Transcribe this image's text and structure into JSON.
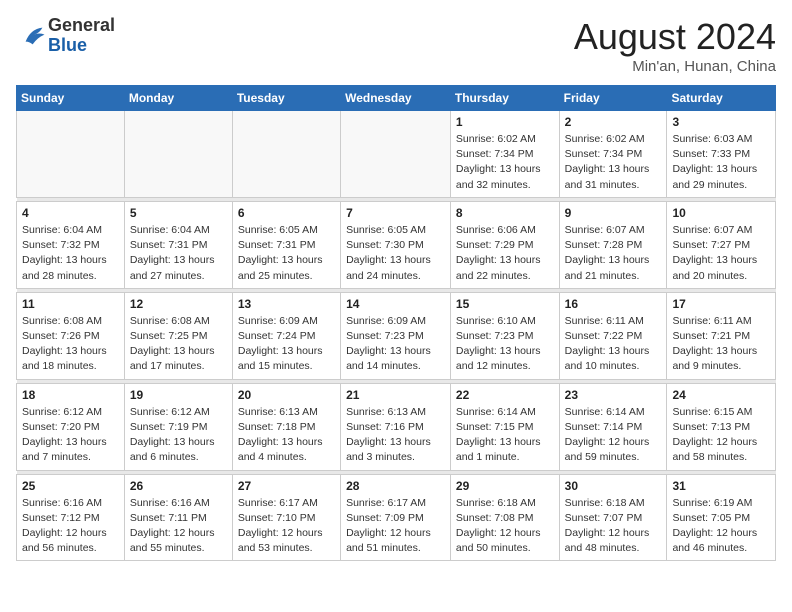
{
  "header": {
    "logo_general": "General",
    "logo_blue": "Blue",
    "month_year": "August 2024",
    "location": "Min'an, Hunan, China"
  },
  "weekdays": [
    "Sunday",
    "Monday",
    "Tuesday",
    "Wednesday",
    "Thursday",
    "Friday",
    "Saturday"
  ],
  "weeks": [
    [
      {
        "day": "",
        "info": ""
      },
      {
        "day": "",
        "info": ""
      },
      {
        "day": "",
        "info": ""
      },
      {
        "day": "",
        "info": ""
      },
      {
        "day": "1",
        "info": "Sunrise: 6:02 AM\nSunset: 7:34 PM\nDaylight: 13 hours and 32 minutes."
      },
      {
        "day": "2",
        "info": "Sunrise: 6:02 AM\nSunset: 7:34 PM\nDaylight: 13 hours and 31 minutes."
      },
      {
        "day": "3",
        "info": "Sunrise: 6:03 AM\nSunset: 7:33 PM\nDaylight: 13 hours and 29 minutes."
      }
    ],
    [
      {
        "day": "4",
        "info": "Sunrise: 6:04 AM\nSunset: 7:32 PM\nDaylight: 13 hours and 28 minutes."
      },
      {
        "day": "5",
        "info": "Sunrise: 6:04 AM\nSunset: 7:31 PM\nDaylight: 13 hours and 27 minutes."
      },
      {
        "day": "6",
        "info": "Sunrise: 6:05 AM\nSunset: 7:31 PM\nDaylight: 13 hours and 25 minutes."
      },
      {
        "day": "7",
        "info": "Sunrise: 6:05 AM\nSunset: 7:30 PM\nDaylight: 13 hours and 24 minutes."
      },
      {
        "day": "8",
        "info": "Sunrise: 6:06 AM\nSunset: 7:29 PM\nDaylight: 13 hours and 22 minutes."
      },
      {
        "day": "9",
        "info": "Sunrise: 6:07 AM\nSunset: 7:28 PM\nDaylight: 13 hours and 21 minutes."
      },
      {
        "day": "10",
        "info": "Sunrise: 6:07 AM\nSunset: 7:27 PM\nDaylight: 13 hours and 20 minutes."
      }
    ],
    [
      {
        "day": "11",
        "info": "Sunrise: 6:08 AM\nSunset: 7:26 PM\nDaylight: 13 hours and 18 minutes."
      },
      {
        "day": "12",
        "info": "Sunrise: 6:08 AM\nSunset: 7:25 PM\nDaylight: 13 hours and 17 minutes."
      },
      {
        "day": "13",
        "info": "Sunrise: 6:09 AM\nSunset: 7:24 PM\nDaylight: 13 hours and 15 minutes."
      },
      {
        "day": "14",
        "info": "Sunrise: 6:09 AM\nSunset: 7:23 PM\nDaylight: 13 hours and 14 minutes."
      },
      {
        "day": "15",
        "info": "Sunrise: 6:10 AM\nSunset: 7:23 PM\nDaylight: 13 hours and 12 minutes."
      },
      {
        "day": "16",
        "info": "Sunrise: 6:11 AM\nSunset: 7:22 PM\nDaylight: 13 hours and 10 minutes."
      },
      {
        "day": "17",
        "info": "Sunrise: 6:11 AM\nSunset: 7:21 PM\nDaylight: 13 hours and 9 minutes."
      }
    ],
    [
      {
        "day": "18",
        "info": "Sunrise: 6:12 AM\nSunset: 7:20 PM\nDaylight: 13 hours and 7 minutes."
      },
      {
        "day": "19",
        "info": "Sunrise: 6:12 AM\nSunset: 7:19 PM\nDaylight: 13 hours and 6 minutes."
      },
      {
        "day": "20",
        "info": "Sunrise: 6:13 AM\nSunset: 7:18 PM\nDaylight: 13 hours and 4 minutes."
      },
      {
        "day": "21",
        "info": "Sunrise: 6:13 AM\nSunset: 7:16 PM\nDaylight: 13 hours and 3 minutes."
      },
      {
        "day": "22",
        "info": "Sunrise: 6:14 AM\nSunset: 7:15 PM\nDaylight: 13 hours and 1 minute."
      },
      {
        "day": "23",
        "info": "Sunrise: 6:14 AM\nSunset: 7:14 PM\nDaylight: 12 hours and 59 minutes."
      },
      {
        "day": "24",
        "info": "Sunrise: 6:15 AM\nSunset: 7:13 PM\nDaylight: 12 hours and 58 minutes."
      }
    ],
    [
      {
        "day": "25",
        "info": "Sunrise: 6:16 AM\nSunset: 7:12 PM\nDaylight: 12 hours and 56 minutes."
      },
      {
        "day": "26",
        "info": "Sunrise: 6:16 AM\nSunset: 7:11 PM\nDaylight: 12 hours and 55 minutes."
      },
      {
        "day": "27",
        "info": "Sunrise: 6:17 AM\nSunset: 7:10 PM\nDaylight: 12 hours and 53 minutes."
      },
      {
        "day": "28",
        "info": "Sunrise: 6:17 AM\nSunset: 7:09 PM\nDaylight: 12 hours and 51 minutes."
      },
      {
        "day": "29",
        "info": "Sunrise: 6:18 AM\nSunset: 7:08 PM\nDaylight: 12 hours and 50 minutes."
      },
      {
        "day": "30",
        "info": "Sunrise: 6:18 AM\nSunset: 7:07 PM\nDaylight: 12 hours and 48 minutes."
      },
      {
        "day": "31",
        "info": "Sunrise: 6:19 AM\nSunset: 7:05 PM\nDaylight: 12 hours and 46 minutes."
      }
    ]
  ]
}
